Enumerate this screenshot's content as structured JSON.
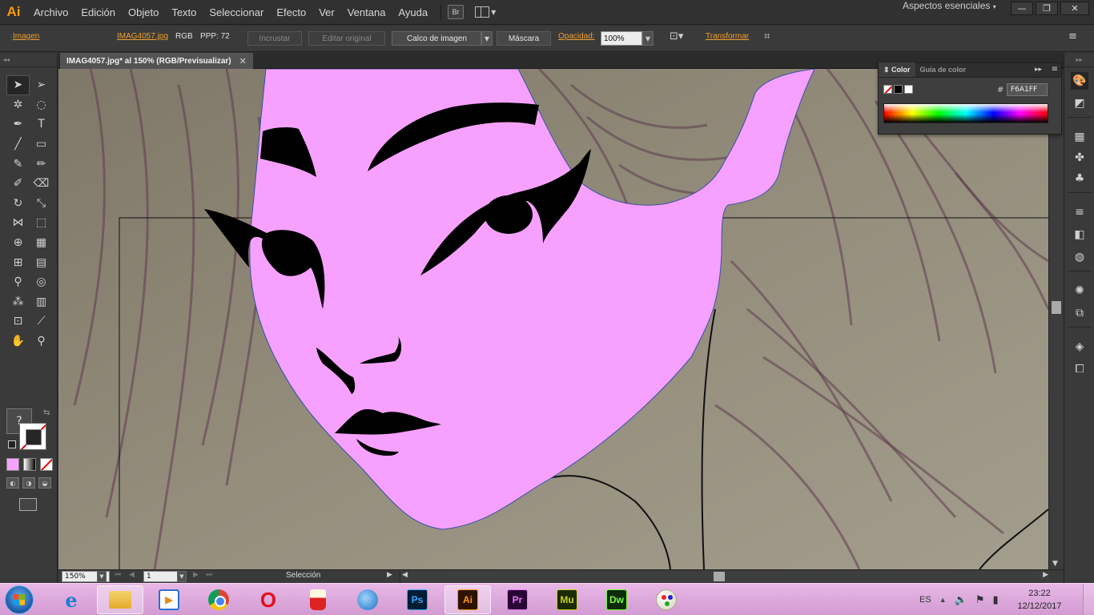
{
  "app": {
    "logo": "Ai",
    "workspace": "Aspectos esenciales"
  },
  "menu": [
    "Archivo",
    "Edición",
    "Objeto",
    "Texto",
    "Seleccionar",
    "Efecto",
    "Ver",
    "Ventana",
    "Ayuda"
  ],
  "menubar_extras": {
    "bridge": "Br",
    "arrange_icon": "arrange-documents-icon"
  },
  "window_controls": {
    "minimize": "—",
    "restore": "❐",
    "close": "✕"
  },
  "control_bar": {
    "object_type": "Imagen",
    "file_name": "IMAG4057.jpg",
    "color_mode": "RGB",
    "ppi": "PPP: 72",
    "embed": "Incrustar",
    "edit_original": "Editar original",
    "image_trace": "Calco de imagen",
    "mask": "Máscara",
    "opacity_label": "Opacidad:",
    "opacity_value": "100%",
    "transform": "Transformar"
  },
  "document": {
    "tab_title": "IMAG4057.jpg* al 150% (RGB/Previsualizar)",
    "close": "✕"
  },
  "tools": [
    {
      "name": "selection-tool",
      "glyph": "➤"
    },
    {
      "name": "direct-selection-tool",
      "glyph": "➢"
    },
    {
      "name": "magic-wand-tool",
      "glyph": "✲"
    },
    {
      "name": "lasso-tool",
      "glyph": "◌"
    },
    {
      "name": "pen-tool",
      "glyph": "✒"
    },
    {
      "name": "type-tool",
      "glyph": "T"
    },
    {
      "name": "line-tool",
      "glyph": "╱"
    },
    {
      "name": "rectangle-tool",
      "glyph": "▭"
    },
    {
      "name": "paintbrush-tool",
      "glyph": "✎"
    },
    {
      "name": "pencil-tool",
      "glyph": "✏"
    },
    {
      "name": "blob-brush-tool",
      "glyph": "✐"
    },
    {
      "name": "eraser-tool",
      "glyph": "⌫"
    },
    {
      "name": "rotate-tool",
      "glyph": "↻"
    },
    {
      "name": "scale-tool",
      "glyph": "⤡"
    },
    {
      "name": "width-tool",
      "glyph": "⋈"
    },
    {
      "name": "free-transform-tool",
      "glyph": "⬚"
    },
    {
      "name": "shape-builder-tool",
      "glyph": "⊕"
    },
    {
      "name": "perspective-grid-tool",
      "glyph": "▦"
    },
    {
      "name": "mesh-tool",
      "glyph": "⊞"
    },
    {
      "name": "gradient-tool",
      "glyph": "▤"
    },
    {
      "name": "eyedropper-tool",
      "glyph": "⚲"
    },
    {
      "name": "blend-tool",
      "glyph": "◎"
    },
    {
      "name": "symbol-sprayer-tool",
      "glyph": "⁂"
    },
    {
      "name": "column-graph-tool",
      "glyph": "▥"
    },
    {
      "name": "artboard-tool",
      "glyph": "⊡"
    },
    {
      "name": "slice-tool",
      "glyph": "⟋"
    },
    {
      "name": "hand-tool",
      "glyph": "✋"
    },
    {
      "name": "zoom-tool",
      "glyph": "⚲"
    }
  ],
  "fill_stroke": {
    "fill_glyph": "?",
    "swap_glyph": "⇆"
  },
  "color_panel": {
    "tabs": [
      "Color",
      "Guía de color"
    ],
    "hex_label": "#",
    "hex": "F6A1FF",
    "more": "▸▸",
    "menu": "≡"
  },
  "status_bar": {
    "zoom": "150%",
    "artboard": "1",
    "current_tool": "Selección"
  },
  "taskbar": {
    "apps": [
      {
        "name": "internet-explorer",
        "label": "e"
      },
      {
        "name": "file-explorer",
        "label": ""
      },
      {
        "name": "media-player",
        "label": "▶"
      },
      {
        "name": "chrome",
        "label": ""
      },
      {
        "name": "opera",
        "label": "O"
      },
      {
        "name": "popcorn-time",
        "label": ""
      },
      {
        "name": "thunderbird",
        "label": ""
      },
      {
        "name": "photoshop",
        "label": "Ps"
      },
      {
        "name": "illustrator",
        "label": "Ai"
      },
      {
        "name": "premiere",
        "label": "Pr"
      },
      {
        "name": "muse",
        "label": "Mu"
      },
      {
        "name": "dreamweaver",
        "label": "Dw"
      },
      {
        "name": "paint",
        "label": ""
      }
    ],
    "language": "ES",
    "time": "23:22",
    "date": "12/12/2017"
  },
  "colors": {
    "fill": "#F6A1FF",
    "accent": "#FF9A00",
    "canvas_bg": "#8f8877"
  }
}
